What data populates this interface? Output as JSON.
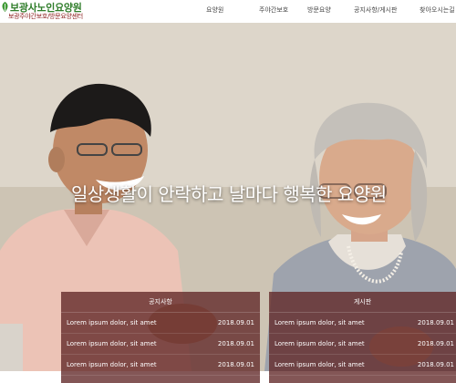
{
  "header": {
    "logo_title": "보광사노인요양원",
    "logo_subtitle": "보광주야간보호/방문요양센터",
    "nav": [
      "요양원",
      "주야간보호",
      "방문요양",
      "공지사항/게시판",
      "찾아오시는길"
    ]
  },
  "hero": {
    "slogan": "일상생활이 안락하고 날마다 행복한 요양원"
  },
  "boards": {
    "notice": {
      "title": "공지사항",
      "rows": [
        {
          "title": "Lorem ipsum dolor, sit amet",
          "date": "2018.09.01"
        },
        {
          "title": "Lorem ipsum dolor, sit amet",
          "date": "2018.09.01"
        },
        {
          "title": "Lorem ipsum dolor, sit amet",
          "date": "2018.09.01"
        }
      ]
    },
    "free": {
      "title": "게시판",
      "rows": [
        {
          "title": "Lorem ipsum dolor, sit amet",
          "date": "2018.09.01"
        },
        {
          "title": "Lorem ipsum dolor, sit amet",
          "date": "2018.09.01"
        },
        {
          "title": "Lorem ipsum dolor, sit amet",
          "date": "2018.09.01"
        }
      ]
    }
  },
  "colors": {
    "logo_green": "#2f7d2a",
    "logo_red": "#8c1f1f",
    "board_bg": "#602626"
  }
}
